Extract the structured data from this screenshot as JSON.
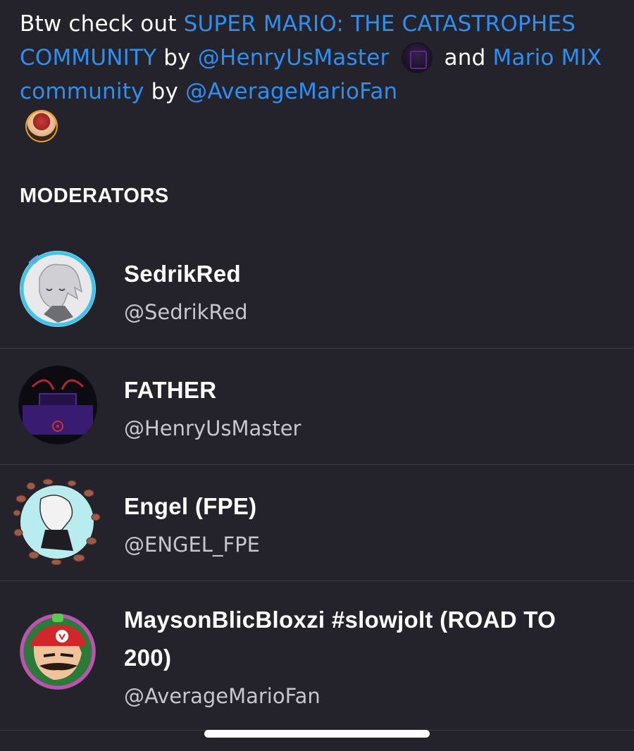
{
  "description": {
    "prefix": "Btw check out ",
    "link1": "SUPER MARIO: THE CATASTROPHES COMMUNITY",
    "by1": " by ",
    "mention1": "@HenryUsMaster",
    "and": " and ",
    "link2": "Mario MIX community",
    "by2": " by ",
    "mention2": "@AverageMarioFan"
  },
  "section_title": "MODERATORS",
  "moderators": [
    {
      "name": "SedrikRed",
      "handle": "@SedrikRed"
    },
    {
      "name": "FATHER",
      "handle": "@HenryUsMaster"
    },
    {
      "name": "Engel (FPE)",
      "handle": "@ENGEL_FPE"
    },
    {
      "name": "MaysonBlicBloxzi #slowjolt (ROAD TO 200)",
      "handle": "@AverageMarioFan"
    }
  ],
  "colors": {
    "background": "#24232b",
    "link": "#2f8ff0",
    "divider": "#3c3b44",
    "text": "#ffffff",
    "secondary_text": "#c7c6cc"
  }
}
